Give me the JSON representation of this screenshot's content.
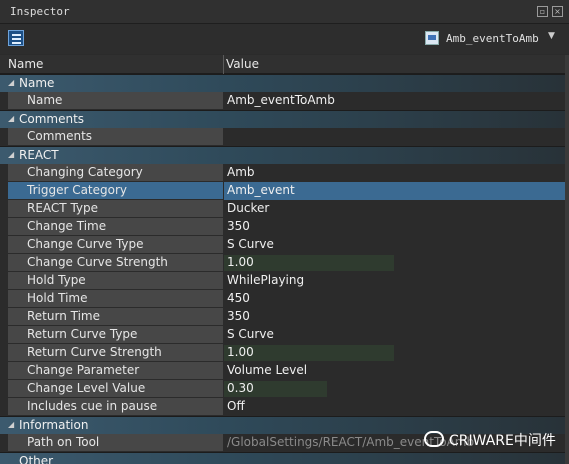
{
  "window": {
    "title": "Inspector"
  },
  "toolbar": {
    "object_selector": "Amb_eventToAmb"
  },
  "grid": {
    "col_name": "Name",
    "col_value": "Value"
  },
  "sections": {
    "name": {
      "label": "Name",
      "props": [
        {
          "name": "Name",
          "value": "Amb_eventToAmb"
        }
      ]
    },
    "comments": {
      "label": "Comments",
      "props": [
        {
          "name": "Comments",
          "value": ""
        }
      ]
    },
    "react": {
      "label": "REACT",
      "props": [
        {
          "name": "Changing Category",
          "value": "Amb"
        },
        {
          "name": "Trigger Category",
          "value": "Amb_event"
        },
        {
          "name": "REACT Type",
          "value": "Ducker"
        },
        {
          "name": "Change Time",
          "value": "350"
        },
        {
          "name": "Change Curve Type",
          "value": "S Curve"
        },
        {
          "name": "Change Curve Strength",
          "value": "1.00"
        },
        {
          "name": "Hold Type",
          "value": "WhilePlaying"
        },
        {
          "name": "Hold Time",
          "value": "450"
        },
        {
          "name": "Return Time",
          "value": "350"
        },
        {
          "name": "Return Curve Type",
          "value": "S Curve"
        },
        {
          "name": "Return Curve Strength",
          "value": "1.00"
        },
        {
          "name": "Change Parameter",
          "value": "Volume Level"
        },
        {
          "name": "Change Level Value",
          "value": "0.30"
        },
        {
          "name": "Includes cue in pause",
          "value": "Off"
        }
      ]
    },
    "information": {
      "label": "Information",
      "props": [
        {
          "name": "Path on Tool",
          "value": "/GlobalSettings/REACT/Amb_eventToAmb"
        }
      ]
    },
    "other": {
      "label": "Other"
    }
  },
  "watermark": "CRIWARE中间件",
  "colors": {
    "selected_row": "#3b6a92",
    "category_band": "#3c5a6e"
  }
}
